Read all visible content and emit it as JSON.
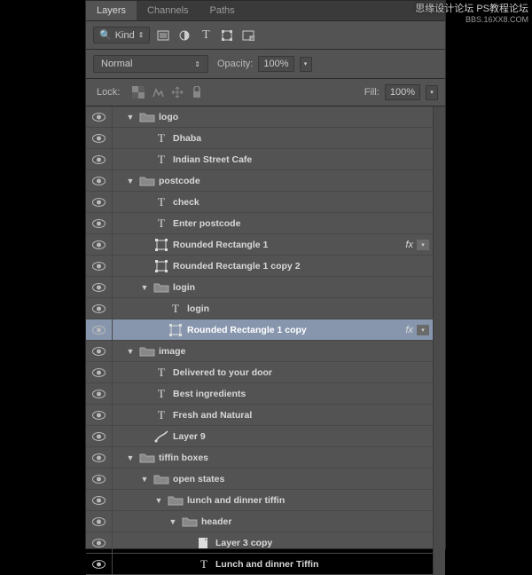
{
  "watermark": {
    "line1": "思缘设计论坛  PS教程论坛",
    "line2": "BBS.16XX8.COM"
  },
  "tabs": {
    "layers": "Layers",
    "channels": "Channels",
    "paths": "Paths"
  },
  "filter": {
    "kind": "Kind"
  },
  "blend": {
    "mode": "Normal",
    "opacity_label": "Opacity:",
    "opacity_value": "100%"
  },
  "lock": {
    "label": "Lock:",
    "fill_label": "Fill:",
    "fill_value": "100%"
  },
  "layers": [
    {
      "indent": 0,
      "type": "group",
      "twist": "down",
      "name": "logo",
      "fx": false
    },
    {
      "indent": 1,
      "type": "text",
      "name": "Dhaba",
      "fx": false
    },
    {
      "indent": 1,
      "type": "text",
      "name": "Indian Street Cafe",
      "fx": false
    },
    {
      "indent": 0,
      "type": "group",
      "twist": "down",
      "name": "postcode",
      "fx": false
    },
    {
      "indent": 1,
      "type": "text",
      "name": "check",
      "fx": false
    },
    {
      "indent": 1,
      "type": "text",
      "name": "Enter postcode",
      "fx": false
    },
    {
      "indent": 1,
      "type": "shape",
      "name": "Rounded Rectangle 1",
      "fx": true
    },
    {
      "indent": 1,
      "type": "shape",
      "name": "Rounded Rectangle 1 copy 2",
      "fx": false
    },
    {
      "indent": 1,
      "type": "group",
      "twist": "down",
      "name": "login",
      "fx": false
    },
    {
      "indent": 2,
      "type": "text",
      "name": "login",
      "fx": false
    },
    {
      "indent": 2,
      "type": "shape",
      "name": "Rounded Rectangle 1 copy",
      "fx": true,
      "selected": true
    },
    {
      "indent": 0,
      "type": "group",
      "twist": "down",
      "name": "image",
      "fx": false
    },
    {
      "indent": 1,
      "type": "text",
      "name": "Delivered to your door",
      "fx": false
    },
    {
      "indent": 1,
      "type": "text",
      "name": "Best ingredients",
      "fx": false
    },
    {
      "indent": 1,
      "type": "text",
      "name": "Fresh and Natural",
      "fx": false
    },
    {
      "indent": 1,
      "type": "brush",
      "name": "Layer 9",
      "fx": false
    },
    {
      "indent": 0,
      "type": "group",
      "twist": "down",
      "name": "tiffin boxes",
      "fx": false
    },
    {
      "indent": 1,
      "type": "group",
      "twist": "down",
      "name": "open states",
      "fx": false
    },
    {
      "indent": 2,
      "type": "group",
      "twist": "down",
      "name": "lunch and dinner tiffin",
      "fx": false
    },
    {
      "indent": 3,
      "type": "group",
      "twist": "down",
      "name": "header",
      "fx": false
    },
    {
      "indent": 4,
      "type": "smart",
      "name": "Layer 3 copy",
      "fx": false
    },
    {
      "indent": 4,
      "type": "text",
      "name": "Lunch and dinner Tiffin",
      "fx": false
    }
  ]
}
